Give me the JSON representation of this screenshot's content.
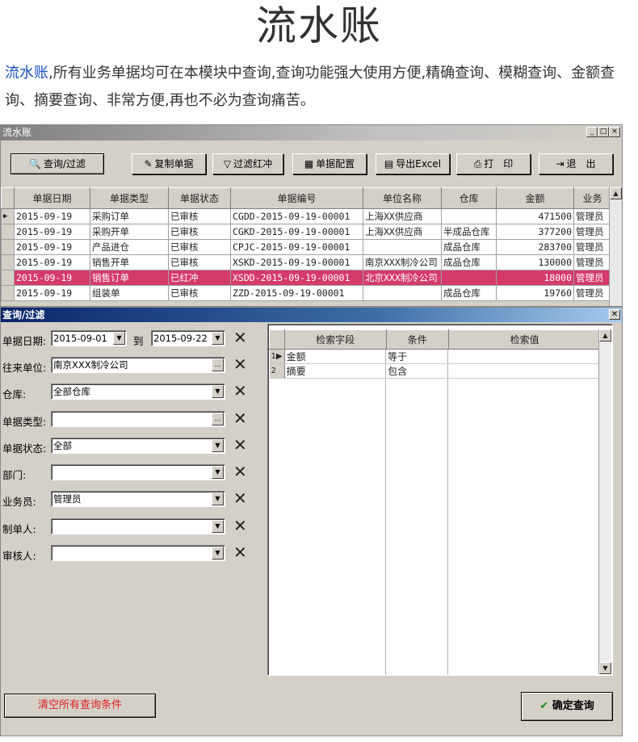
{
  "header": {
    "title": "流水账",
    "intro_highlight": "流水账",
    "intro_rest": ",所有业务单据均可在本模块中查询,查询功能强大使用方便,精确查询、模糊查询、金额查询、摘要查询、非常方便,再也不必为查询痛苦。"
  },
  "window": {
    "title": "流水账",
    "controls": [
      "_",
      "□",
      "×"
    ]
  },
  "toolbar": {
    "query_filter": "查询/过滤",
    "copy_doc": "复制单据",
    "filter_red": "过滤红冲",
    "doc_config": "单据配置",
    "export_excel": "导出Excel",
    "print": "打　印",
    "exit": "退　出"
  },
  "grid": {
    "columns": [
      "单据日期",
      "单据类型",
      "单据状态",
      "单据编号",
      "单位名称",
      "仓库",
      "金额",
      "业务"
    ],
    "rows": [
      {
        "date": "2015-09-19",
        "type": "采购订单",
        "status": "已审核",
        "no": "CGDD-2015-09-19-00001",
        "unit": "上海XX供应商",
        "wh": "",
        "amount": "471500",
        "staff": "管理员"
      },
      {
        "date": "2015-09-19",
        "type": "采购开单",
        "status": "已审核",
        "no": "CGKD-2015-09-19-00001",
        "unit": "上海XX供应商",
        "wh": "半成品仓库",
        "amount": "377200",
        "staff": "管理员"
      },
      {
        "date": "2015-09-19",
        "type": "产品进仓",
        "status": "已审核",
        "no": "CPJC-2015-09-19-00001",
        "unit": "",
        "wh": "成品仓库",
        "amount": "283700",
        "staff": "管理员"
      },
      {
        "date": "2015-09-19",
        "type": "销售开单",
        "status": "已审核",
        "no": "XSKD-2015-09-19-00001",
        "unit": "南京XXX制冷公司",
        "wh": "成品仓库",
        "amount": "130000",
        "staff": "管理员"
      },
      {
        "date": "2015-09-19",
        "type": "销售订单",
        "status": "已红冲",
        "no": "XSDD-2015-09-19-00001",
        "unit": "北京XXX制冷公司",
        "wh": "",
        "amount": "18000",
        "staff": "管理员"
      },
      {
        "date": "2015-09-19",
        "type": "组装单",
        "status": "已审核",
        "no": "ZZD-2015-09-19-00001",
        "unit": "",
        "wh": "成品仓库",
        "amount": "19760",
        "staff": "管理员"
      }
    ]
  },
  "query_panel": {
    "title": "查询/过滤",
    "date_label": "单据日期:",
    "date_from": "2015-09-01",
    "to_label": "到",
    "date_to": "2015-09-22",
    "partner_label": "往来单位:",
    "partner_value": "南京XXX制冷公司",
    "warehouse_label": "仓库:",
    "warehouse_value": "全部仓库",
    "doctype_label": "单据类型:",
    "doctype_value": "",
    "docstatus_label": "单据状态:",
    "docstatus_value": "全部",
    "dept_label": "部门:",
    "dept_value": "",
    "staff_label": "业务员:",
    "staff_value": "管理员",
    "maker_label": "制单人:",
    "maker_value": "",
    "auditor_label": "审核人:",
    "auditor_value": "",
    "conditions": {
      "columns": [
        "检索字段",
        "条件",
        "检索值"
      ],
      "rows": [
        {
          "idx": "1",
          "field": "金额",
          "cond": "等于",
          "value": ""
        },
        {
          "idx": "2",
          "field": "摘要",
          "cond": "包含",
          "value": ""
        }
      ]
    },
    "clear_button": "清空所有查询条件",
    "confirm_button": "确定查询"
  }
}
